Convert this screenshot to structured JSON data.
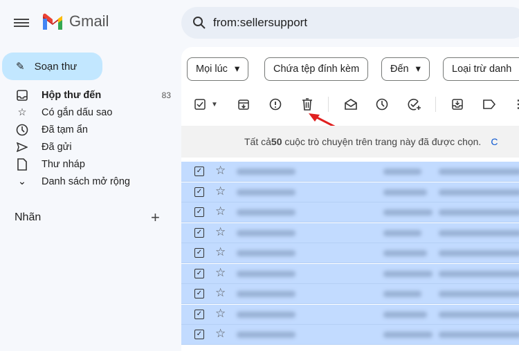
{
  "app": {
    "name": "Gmail"
  },
  "search": {
    "value": "from:sellersupport"
  },
  "compose": {
    "label": "Soạn thư"
  },
  "nav": [
    {
      "label": "Hộp thư đến",
      "count": "83",
      "icon": "inbox-icon"
    },
    {
      "label": "Có gắn dấu sao",
      "icon": "star-icon"
    },
    {
      "label": "Đã tạm ẩn",
      "icon": "clock-icon"
    },
    {
      "label": "Đã gửi",
      "icon": "send-icon"
    },
    {
      "label": "Thư nháp",
      "icon": "draft-icon"
    },
    {
      "label": "Danh sách mở rộng",
      "icon": "chevron-down-icon"
    }
  ],
  "labels": {
    "title": "Nhãn"
  },
  "filters": [
    "Mọi lúc",
    "Chứa tệp đính kèm",
    "Đến",
    "Loại trừ danh"
  ],
  "banner": {
    "pre": "Tất cả ",
    "count": "50",
    "post": " cuộc trò chuyện trên trang này đã được chọn.",
    "link": "C"
  },
  "colors": {
    "selected_row": "#c2dbff",
    "compose": "#c2e7ff",
    "arrow": "#e02020"
  }
}
